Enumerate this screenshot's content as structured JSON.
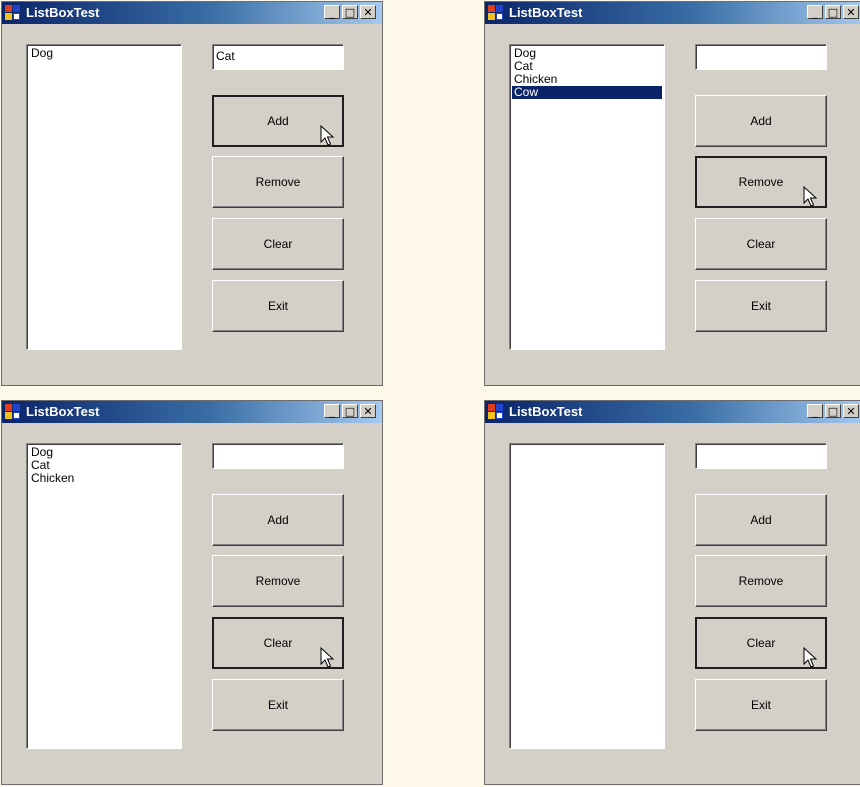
{
  "windows": [
    {
      "title": "ListBoxTest",
      "list_items": [
        {
          "label": "Dog",
          "selected": false
        }
      ],
      "textbox_value": "Cat",
      "buttons": {
        "add": "Add",
        "remove": "Remove",
        "clear": "Clear",
        "exit": "Exit"
      },
      "focused_button": "add",
      "cursor_over": "add"
    },
    {
      "title": "ListBoxTest",
      "list_items": [
        {
          "label": "Dog",
          "selected": false
        },
        {
          "label": "Cat",
          "selected": false
        },
        {
          "label": "Chicken",
          "selected": false
        },
        {
          "label": "Cow",
          "selected": true
        }
      ],
      "textbox_value": "",
      "buttons": {
        "add": "Add",
        "remove": "Remove",
        "clear": "Clear",
        "exit": "Exit"
      },
      "focused_button": "remove",
      "cursor_over": "remove"
    },
    {
      "title": "ListBoxTest",
      "list_items": [
        {
          "label": "Dog",
          "selected": false
        },
        {
          "label": "Cat",
          "selected": false
        },
        {
          "label": "Chicken",
          "selected": false
        }
      ],
      "textbox_value": "",
      "buttons": {
        "add": "Add",
        "remove": "Remove",
        "clear": "Clear",
        "exit": "Exit"
      },
      "focused_button": "clear",
      "cursor_over": "clear"
    },
    {
      "title": "ListBoxTest",
      "list_items": [],
      "textbox_value": "",
      "buttons": {
        "add": "Add",
        "remove": "Remove",
        "clear": "Clear",
        "exit": "Exit"
      },
      "focused_button": "clear",
      "cursor_over": "clear"
    }
  ],
  "caption_buttons": {
    "minimize": "_",
    "maximize": "□",
    "close": "✕"
  },
  "colors": {
    "title_start": "#0a246a",
    "title_end": "#a6caf0",
    "window_face": "#d4d0c8",
    "selection": "#0a246a",
    "page_bg": "#fdf8e8"
  }
}
